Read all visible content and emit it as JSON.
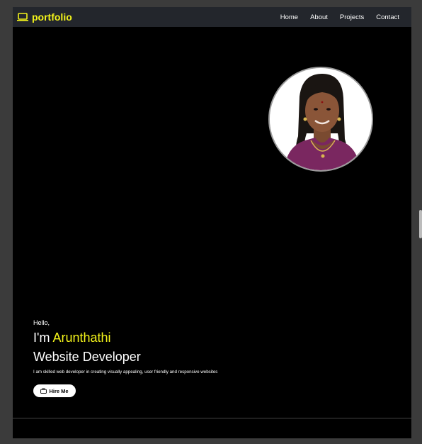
{
  "navbar": {
    "brand": "portfolio",
    "links": [
      "Home",
      "About",
      "Projects",
      "Contact"
    ]
  },
  "hero": {
    "greeting": "Hello,",
    "intro_prefix": "I'm ",
    "name": "Arunthathi",
    "role": "Website Developer",
    "description": "I am skilled web developer in creating visually appealing, user friendly and responsive websites",
    "hire_button": "Hire Me"
  },
  "icons": {
    "brand": "laptop-icon",
    "hire": "briefcase-icon"
  },
  "colors": {
    "accent": "#f4f41a",
    "navbar_bg": "#23262c",
    "page_bg": "#000000"
  }
}
